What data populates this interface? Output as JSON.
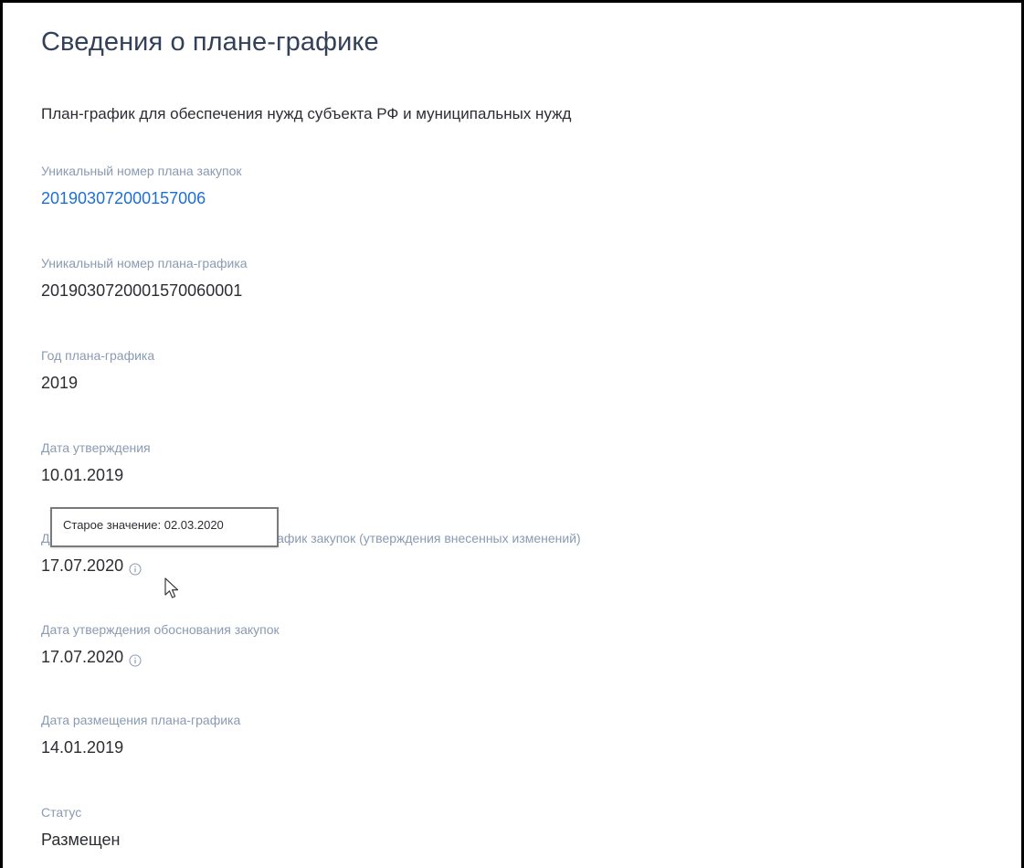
{
  "page": {
    "title": "Сведения о плане-графике",
    "subtitle": "План-график для обеспечения нужд субъекта РФ и муниципальных нужд"
  },
  "fields": [
    {
      "label": "Уникальный номер плана закупок",
      "value": "201903072000157006",
      "is_link": true
    },
    {
      "label": "Уникальный номер плана-графика",
      "value": "2019030720001570060001"
    },
    {
      "label": "Год плана-графика",
      "value": "2019"
    },
    {
      "label": "Дата утверждения",
      "value": "10.01.2019"
    },
    {
      "label": "Дата утверждения изменений в план-график закупок (утверждения внесенных изменений)",
      "label_visible_part": "лан-график закупок (утверждения внесенных изменений)",
      "value": "17.07.2020",
      "info_icon": "info-icon"
    },
    {
      "label": "Дата утверждения обоснования закупок",
      "value": "17.07.2020",
      "info_icon": "info-icon"
    },
    {
      "label": "Дата размещения плана-графика",
      "value": "14.01.2019"
    },
    {
      "label": "Статус",
      "value": "Размещен"
    }
  ],
  "tooltip": {
    "text": "Старое значение: 02.03.2020"
  },
  "colors": {
    "title": "#334059",
    "label": "#8a9ab2",
    "text": "#2b2d33",
    "link": "#1d6fd6",
    "icon": "#8a9ab2"
  },
  "cursor": "arrow-pointer-icon"
}
